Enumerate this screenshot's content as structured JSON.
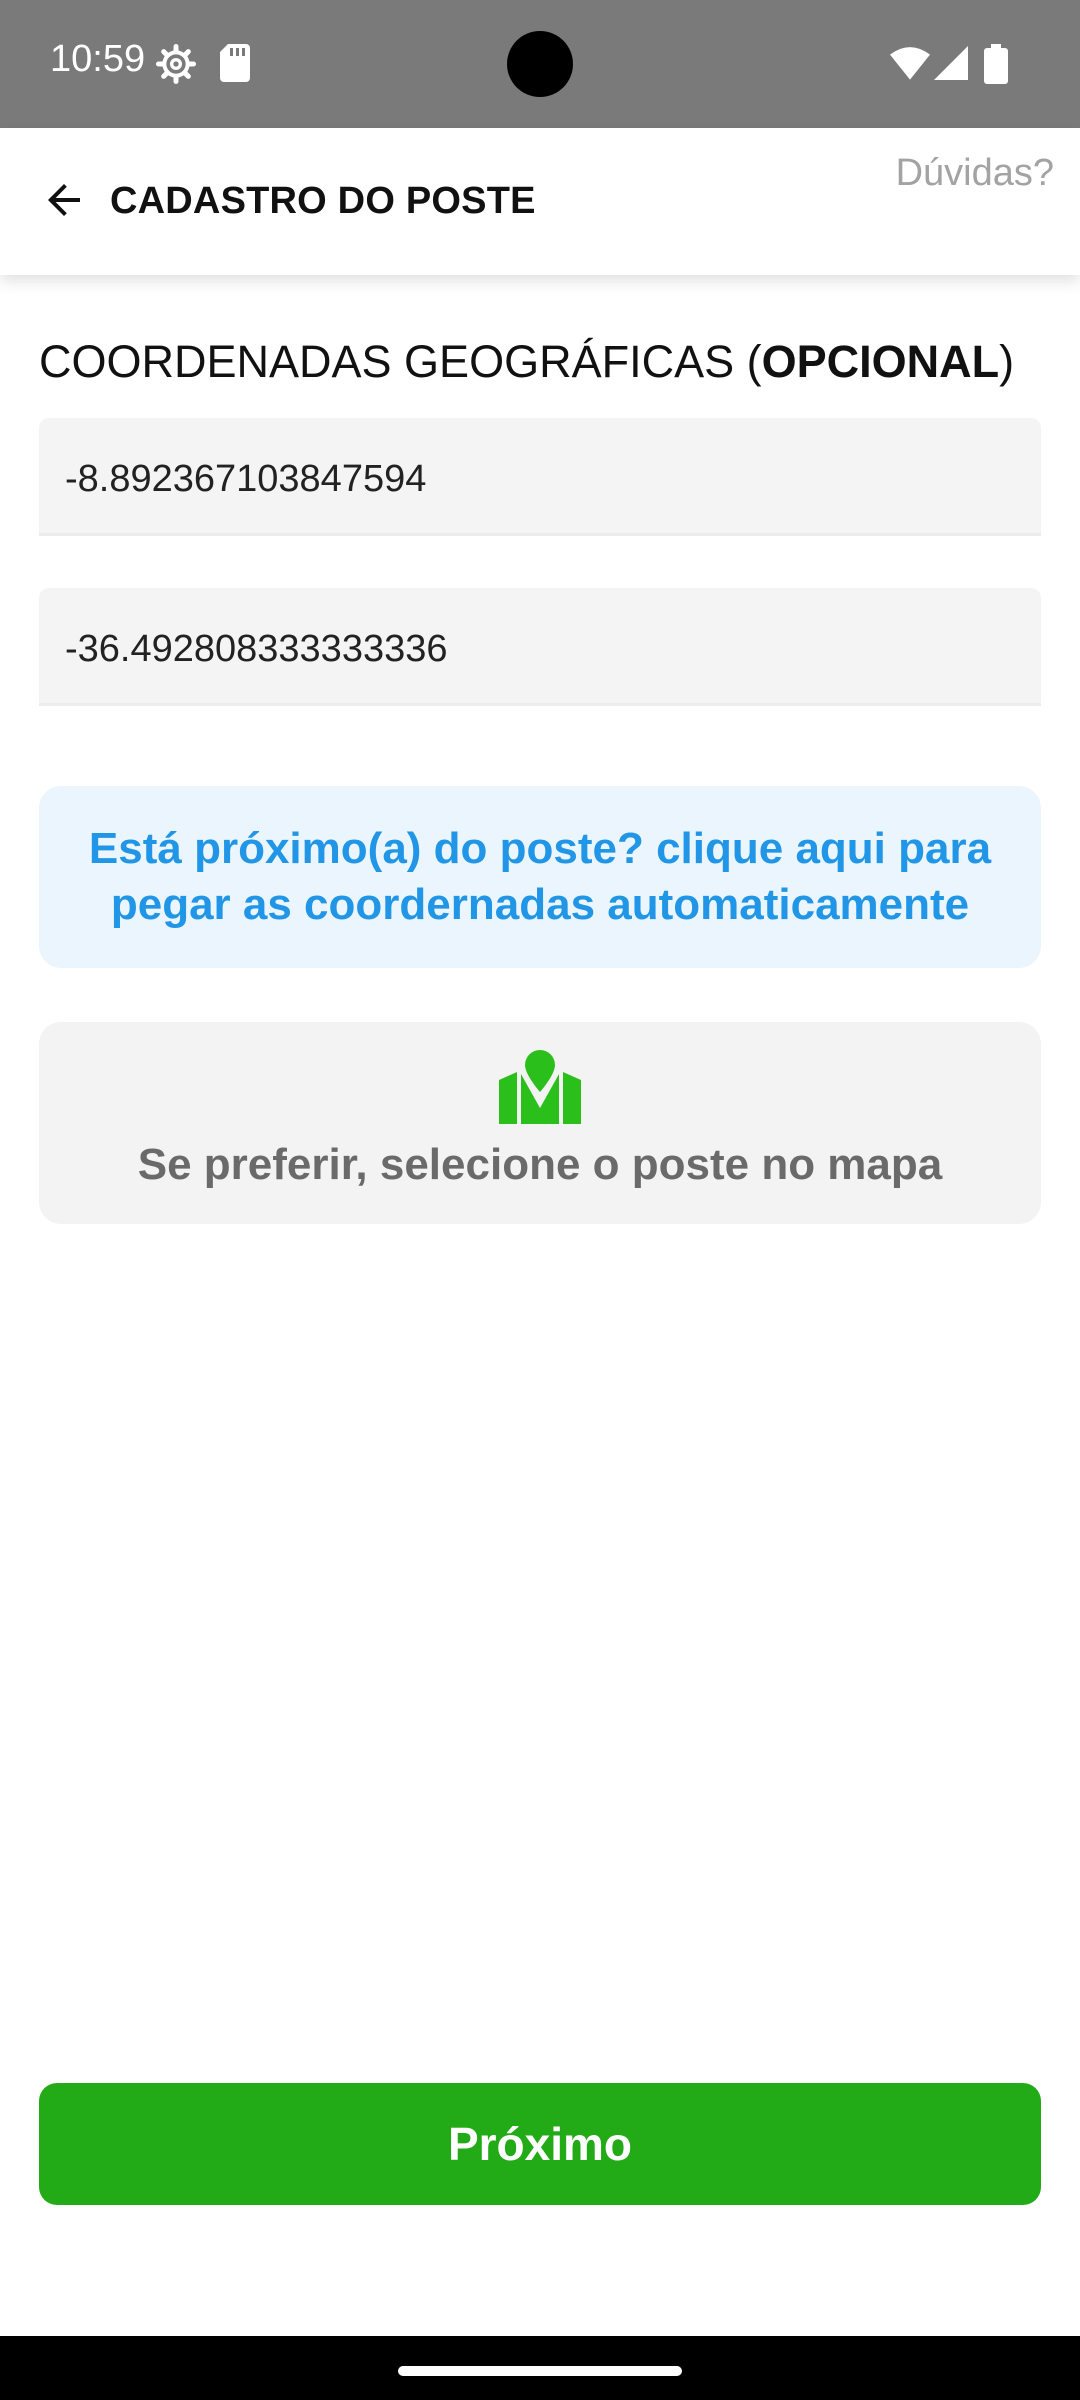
{
  "status_bar": {
    "time": "10:59",
    "icons": [
      "gear-icon",
      "sd-card-icon",
      "wifi-icon",
      "signal-icon",
      "battery-icon"
    ]
  },
  "app_bar": {
    "title": "CADASTRO DO POSTE",
    "help_label": "Dúvidas?",
    "back_icon": "arrow-left-icon"
  },
  "coordinates": {
    "label_prefix": "COORDENADAS GEOGRÁFICAS (",
    "label_bold": "OPCIONAL",
    "label_suffix": ")",
    "latitude": "-8.892367103847594",
    "longitude": "-36.492808333333336"
  },
  "auto_coords_button": {
    "label": "Está próximo(a) do poste? clique aqui para pegar as coordernadas automaticamente"
  },
  "map_select": {
    "icon": "map-marker-icon",
    "label": "Se preferir, selecione o poste no mapa"
  },
  "next_button": {
    "label": "Próximo"
  },
  "colors": {
    "status_bar": "#7a7a7a",
    "accent_blue": "#2196e6",
    "blue_bg": "#ebf5fe",
    "green": "#22ab16",
    "map_icon_green": "#2bbf1c",
    "field_bg": "#f4f4f4",
    "help_gray": "#a3a3a3"
  }
}
